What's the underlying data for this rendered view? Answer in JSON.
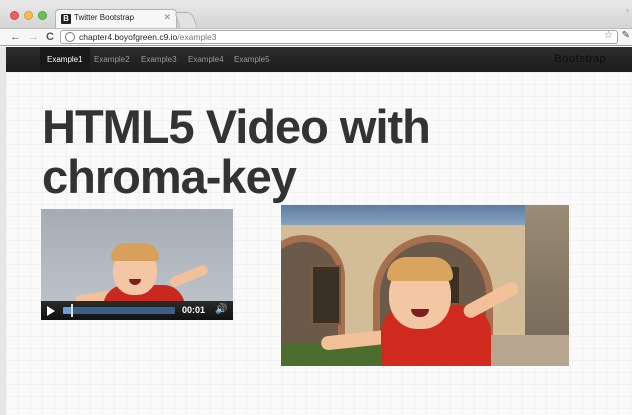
{
  "browser": {
    "tab_title": "Twitter Bootstrap",
    "tab_favicon_letter": "B",
    "tab_close_glyph": "✕",
    "url_host": "chapter4.boyofgreen.c9.io",
    "url_path": "/example3",
    "icons": {
      "back": "back-arrow-icon",
      "forward": "forward-arrow-icon",
      "reload": "reload-icon",
      "star": "bookmark-star-icon",
      "wrench": "wrench-icon"
    }
  },
  "navbar": {
    "items": [
      {
        "label": "Example1",
        "active": true
      },
      {
        "label": "Example2",
        "active": false
      },
      {
        "label": "Example3",
        "active": false
      },
      {
        "label": "Example4",
        "active": false
      },
      {
        "label": "Example5",
        "active": false
      }
    ],
    "brand": "Bootstrap"
  },
  "main": {
    "heading_line1": "HTML5 Video with",
    "heading_line2": "chroma-key"
  },
  "video_player": {
    "time": "00:01",
    "progress_fraction": 0.08,
    "icons": {
      "play": "play-icon",
      "volume": "volume-icon"
    }
  },
  "colors": {
    "navbar_bg": "#1b1b1b",
    "nav_active_text": "#ffffff",
    "nav_text": "#999999",
    "heading_text": "#333333",
    "seek_fill": "#6d9fd6"
  }
}
